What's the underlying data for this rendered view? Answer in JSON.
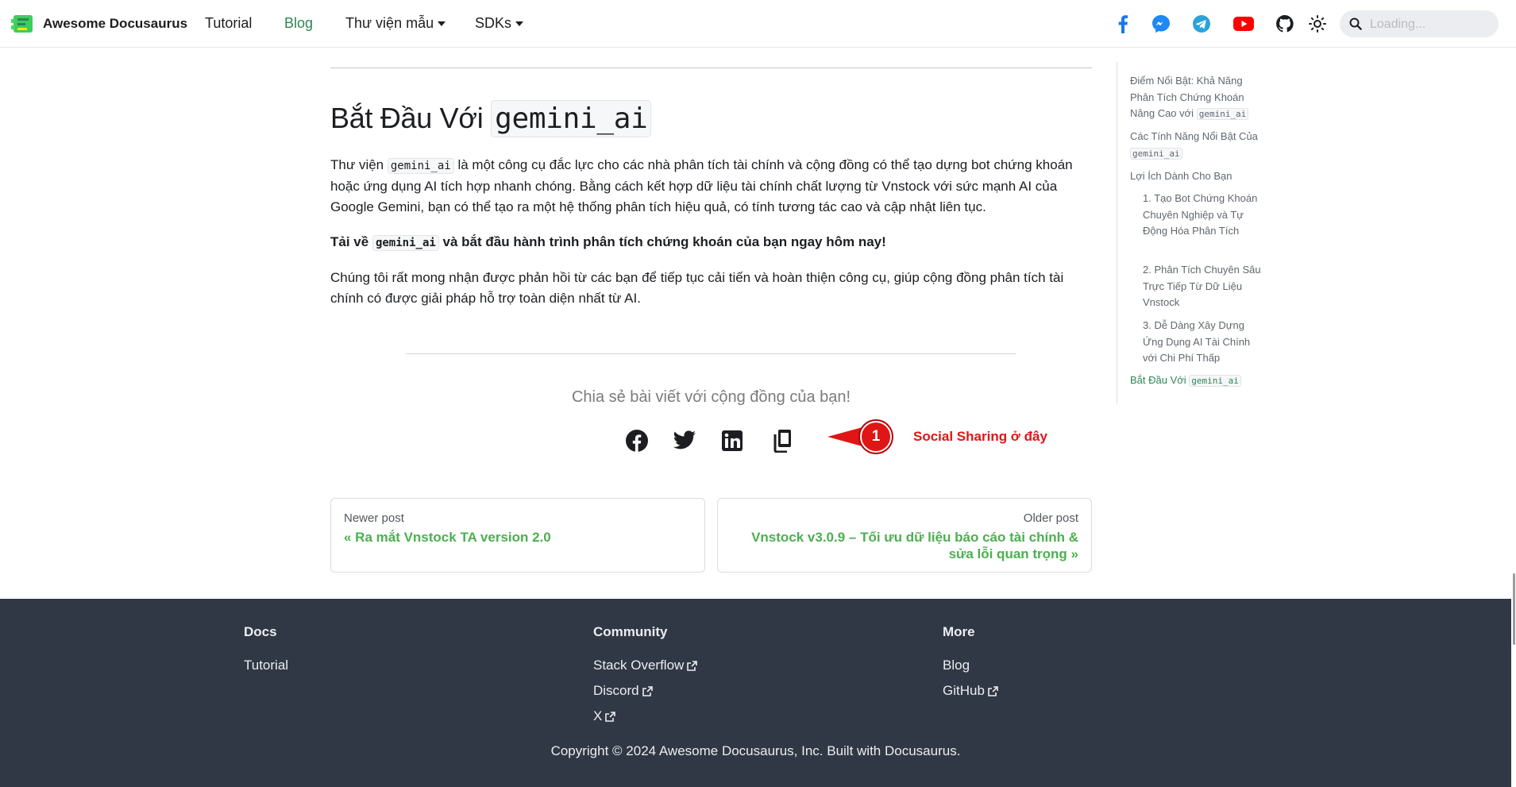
{
  "navbar": {
    "brand": "Awesome Docusaurus",
    "links": {
      "tutorial": "Tutorial",
      "blog": "Blog",
      "library": "Thư viện mẫu",
      "sdks": "SDKs"
    },
    "search_placeholder": "Loading..."
  },
  "article": {
    "heading_prefix": "Bắt Đầu Với",
    "heading_code": "gemini_ai",
    "p1_a": "Thư viện",
    "p1_code": "gemini_ai",
    "p1_b": "là một công cụ đắc lực cho các nhà phân tích tài chính và cộng đồng có thể tạo dựng bot chứng khoán hoặc ứng dụng AI tích hợp nhanh chóng. Bằng cách kết hợp dữ liệu tài chính chất lượng từ Vnstock với sức mạnh AI của Google Gemini, bạn có thể tạo ra một hệ thống phân tích hiệu quả, có tính tương tác cao và cập nhật liên tục.",
    "p2_a": "Tải về",
    "p2_code": "gemini_ai",
    "p2_b": "và bắt đầu hành trình phân tích chứng khoán của bạn ngay hôm nay!",
    "p3": "Chúng tôi rất mong nhận được phản hồi từ các bạn để tiếp tục cải tiến và hoàn thiện công cụ, giúp cộng đồng phân tích tài chính có được giải pháp hỗ trợ toàn diện nhất từ AI."
  },
  "share": {
    "title": "Chia sẻ bài viết với cộng đồng của bạn!"
  },
  "annotation": {
    "number": "1",
    "label": "Social Sharing ở đây"
  },
  "pager": {
    "prev_sub": "Newer post",
    "prev_title": "« Ra mắt Vnstock TA version 2.0",
    "next_sub": "Older post",
    "next_title": "Vnstock v3.0.9 – Tối ưu dữ liệu báo cáo tài chính & sửa lỗi quan trọng »"
  },
  "toc": {
    "item1_text": "Điểm Nổi Bật: Khả Năng Phân Tích Chứng Khoán Nâng Cao với",
    "item1_code": "gemini_ai",
    "item2_text": "Các Tính Năng Nổi Bật Của",
    "item2_code": "gemini_ai",
    "item3": "Lợi Ích Dành Cho Bạn",
    "item4": "1. Tạo Bot Chứng Khoán Chuyên Nghiệp và Tự Động Hóa Phân Tích",
    "item5": "2. Phân Tích Chuyên Sâu Trực Tiếp Từ Dữ Liệu Vnstock",
    "item6": "3. Dễ Dàng Xây Dựng Ứng Dụng AI Tài Chính với Chi Phí Thấp",
    "item7_text": "Bắt Đầu Với",
    "item7_code": "gemini_ai"
  },
  "footer": {
    "docs_title": "Docs",
    "docs_tutorial": "Tutorial",
    "community_title": "Community",
    "stackoverflow": "Stack Overflow",
    "discord": "Discord",
    "x": "X",
    "more_title": "More",
    "blog": "Blog",
    "github": "GitHub",
    "copyright": "Copyright © 2024 Awesome Docusaurus, Inc. Built with Docusaurus."
  },
  "colors": {
    "accent": "#2e8555",
    "link_green": "#4caf50",
    "footer_bg": "#303846",
    "annotation_red": "#e01515"
  },
  "icons": [
    "facebook-icon",
    "messenger-icon",
    "telegram-icon",
    "youtube-icon",
    "github-icon",
    "theme-toggle-icon",
    "search-icon",
    "share-facebook-icon",
    "share-twitter-icon",
    "share-linkedin-icon",
    "copy-link-icon",
    "external-link-icon"
  ]
}
